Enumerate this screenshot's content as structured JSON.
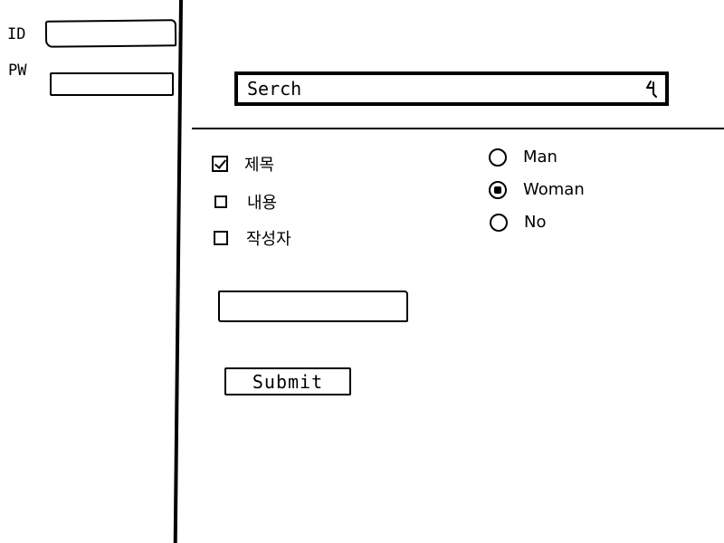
{
  "login": {
    "id_label": "ID",
    "id_value": "",
    "pw_label": "PW",
    "pw_value": ""
  },
  "search": {
    "placeholder": "Serch",
    "value": "",
    "icon": "search-icon"
  },
  "checkboxes": [
    {
      "label": "제목",
      "checked": true
    },
    {
      "label": "내용",
      "checked": false
    },
    {
      "label": "작성자",
      "checked": false
    }
  ],
  "radios": [
    {
      "label": "Man",
      "checked": false
    },
    {
      "label": "Woman",
      "checked": true
    },
    {
      "label": "No",
      "checked": false
    }
  ],
  "extra_field": {
    "value": ""
  },
  "submit": {
    "label": "Submit"
  }
}
